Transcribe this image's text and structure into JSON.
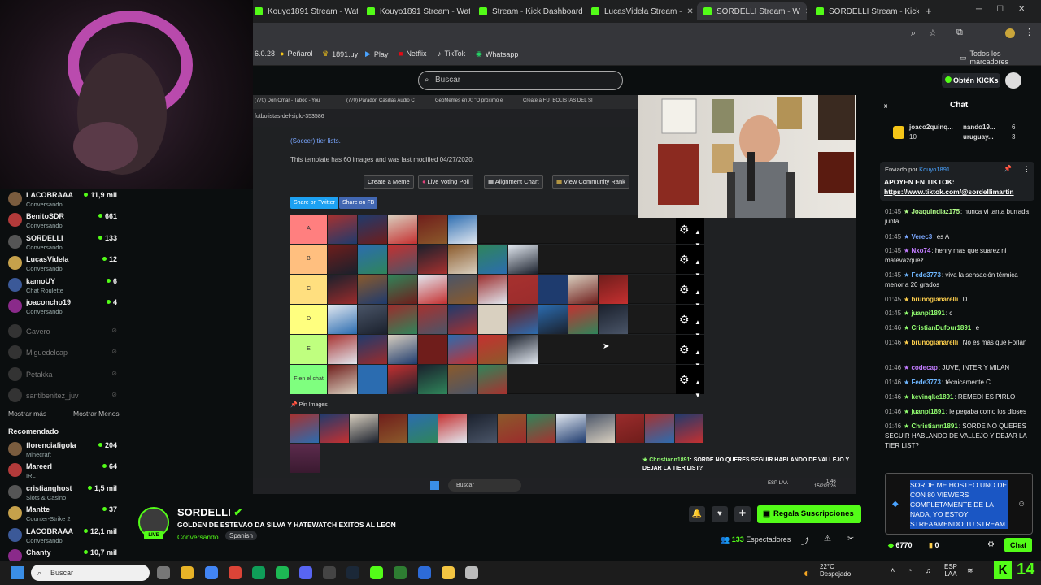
{
  "browser": {
    "tabs": [
      {
        "label": "Kouyo1891 Stream - Watc"
      },
      {
        "label": "Kouyo1891 Stream - Watc"
      },
      {
        "label": "Stream - Kick Dashboard"
      },
      {
        "label": "LucasVidela Stream -"
      },
      {
        "label": "SORDELLI Stream - W"
      },
      {
        "label": "SORDELLI Stream - Kick D"
      }
    ],
    "bookmarks": [
      "6.0.28",
      "Peñarol",
      "1891.uy",
      "Play",
      "Netflix",
      "TikTok",
      "Whatsapp"
    ],
    "bookmarks_right": "Todos los marcadores"
  },
  "header": {
    "search_placeholder": "Buscar",
    "kicks_label": "Obtén KICKs"
  },
  "sidebar": {
    "following": [
      {
        "name": "LACOBRAAA",
        "game": "Conversando",
        "viewers": "11,9 mil"
      },
      {
        "name": "BenitoSDR",
        "game": "Conversando",
        "viewers": "661"
      },
      {
        "name": "SORDELLI",
        "game": "Conversando",
        "viewers": "133"
      },
      {
        "name": "LucasVidela",
        "game": "Conversando",
        "viewers": "12"
      },
      {
        "name": "kamoUY",
        "game": "Chat Roulette",
        "viewers": "6"
      },
      {
        "name": "joaconcho19",
        "game": "Conversando",
        "viewers": "4"
      }
    ],
    "offline": [
      "Gavero",
      "Miguedelcap",
      "Petakka",
      "santibenitez_juv"
    ],
    "show_more": "Mostrar más",
    "show_less": "Mostrar Menos",
    "recommended_title": "Recomendado",
    "recommended": [
      {
        "name": "florenciafigola",
        "game": "Minecraft",
        "viewers": "204"
      },
      {
        "name": "Mareerl",
        "game": "IRL",
        "viewers": "64"
      },
      {
        "name": "cristianghost",
        "game": "Slots & Casino",
        "viewers": "1,5 mil"
      },
      {
        "name": "Mantte",
        "game": "Counter-Strike 2",
        "viewers": "37"
      },
      {
        "name": "LACOBRAAA",
        "game": "Conversando",
        "viewers": "12,1 mil"
      },
      {
        "name": "Chanty",
        "game": "",
        "viewers": "10,7 mil"
      }
    ]
  },
  "inner": {
    "tabs": [
      "(770) Don Omar - Taboo - You",
      "(770) Paradon Casillas Audio C",
      "GeoMemes en X: \"O próximo e",
      "Create a FUTBOLISTAS DEL SI"
    ],
    "url": "futbolistas-del-siglo-353586",
    "category_link": "(Soccer) tier lists.",
    "template_info": "This template has 60 images and was last modified 04/27/2020.",
    "buttons": [
      "Create a Meme",
      "Live Voting Poll",
      "Alignment Chart",
      "View Community Rank"
    ],
    "share_twitter": "Share on Twitter",
    "share_fb": "Share on FB",
    "tiers": [
      {
        "label": "A",
        "color": "#ff7f7f",
        "count": 5
      },
      {
        "label": "B",
        "color": "#ffbf7f",
        "count": 7
      },
      {
        "label": "C",
        "color": "#ffdf7f",
        "count": 10
      },
      {
        "label": "D",
        "color": "#ffff7f",
        "count": 10
      },
      {
        "label": "E",
        "color": "#bfff7f",
        "count": 7
      },
      {
        "label": "F en el chat",
        "color": "#7fff7f",
        "count": 6
      }
    ],
    "pin_label": "Pin Images",
    "overlay_user": "Christiann1891",
    "overlay_msg": ": SORDE NO QUERES SEGUIR HABLANDO DE VALLEJO Y DEJAR LA TIER LIST?",
    "taskbar_search": "Buscar",
    "clock_time": "1:46",
    "clock_date": "15/2/2026",
    "lang": "ESP LAA"
  },
  "chat": {
    "title": "Chat",
    "top_gifters": [
      {
        "name": "joaco2quinq...",
        "count": "10"
      },
      {
        "name": "nando19...",
        "count": "6"
      },
      {
        "name": "uruguay...",
        "count": "3"
      }
    ],
    "pinned_by_label": "Enviado por",
    "pinned_by": "Kouyo1891",
    "pinned_text": "APOYEN EN TIKTOK:",
    "pinned_link": "https://www.tiktok.com/@sordellimartin",
    "messages": [
      {
        "time": "01:45",
        "user": "Joaquindiaz175",
        "color": "#b3ff8a",
        "text": ": nunca vi tanta burrada junta"
      },
      {
        "time": "01:45",
        "user": "Verec3",
        "color": "#7aa7ff",
        "text": ": es A"
      },
      {
        "time": "01:45",
        "user": "Nxo74",
        "color": "#c27cff",
        "text": ": henry mas que suarez ni matevazquez"
      },
      {
        "time": "01:45",
        "user": "Fede3773",
        "color": "#6fb7ff",
        "text": ": viva la sensación térmica menor a 20 grados"
      },
      {
        "time": "01:45",
        "user": "brunogianarelli",
        "color": "#ffd04d",
        "text": ": D"
      },
      {
        "time": "01:45",
        "user": "juanpi1891",
        "color": "#93ff71",
        "text": ": c"
      },
      {
        "time": "01:46",
        "user": "CristianDufour1891",
        "color": "#93ff71",
        "text": ": e"
      },
      {
        "time": "01:46",
        "user": "brunogianarelli",
        "color": "#ffd04d",
        "text": ": No es más que Forlán"
      },
      {
        "time": "01:46",
        "user": "codecap",
        "color": "#c27cff",
        "text": ": JUVE, INTER Y MILAN"
      },
      {
        "time": "01:46",
        "user": "Fede3773",
        "color": "#6fb7ff",
        "text": ": técnicamente C"
      },
      {
        "time": "01:46",
        "user": "kevinqke1891",
        "color": "#93ff71",
        "text": ": REMEDI ES PIRLO"
      },
      {
        "time": "01:46",
        "user": "juanpi1891",
        "color": "#93ff71",
        "text": ": le pegaba como los dioses"
      },
      {
        "time": "01:46",
        "user": "Christiann1891",
        "color": "#93ff71",
        "text": ": SORDE NO QUERES SEGUIR HABLANDO DE VALLEJO Y DEJAR LA TIER LIST?"
      }
    ],
    "input_text": "SORDE ME HOSTEO UNO DE CON 80 VIEWERS COMPLETAMENTE DE LA NADA, YO ESTOY STREAAMENDO TU STREAM",
    "kicks_balance": "6770",
    "points": "0",
    "send_label": "Chat"
  },
  "streamer": {
    "name": "SORDELLI",
    "title": "GOLDEN DE ESTEVAO DA SILVA Y HATEWATCH EXITOS AL LEON",
    "category": "Conversando",
    "language": "Spanish",
    "live_badge": "LIVE",
    "subscribe_label": "Regala Suscripciones",
    "viewers": "133",
    "viewers_label": "Espectadores"
  },
  "taskbar": {
    "search": "Buscar",
    "temp": "22°C",
    "weather": "Despejado",
    "lang_top": "ESP",
    "lang_bottom": "LAA",
    "kick_count": "14"
  }
}
